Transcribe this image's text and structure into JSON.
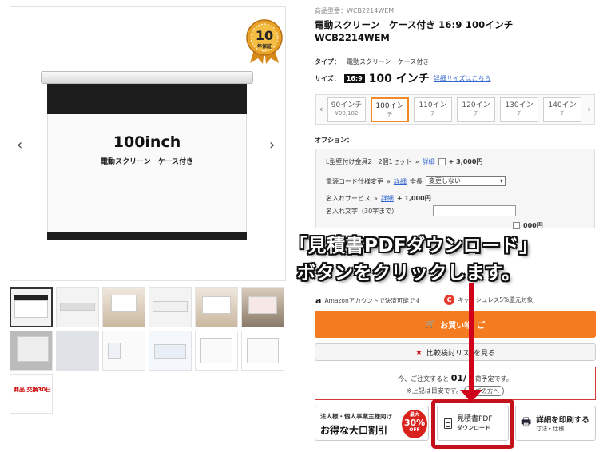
{
  "gallery": {
    "screen_text": "100inch",
    "screen_sub": "電動スクリーン　ケース付き",
    "badge_number": "10",
    "badge_text": "年保証",
    "prev_icon": "chevron-left",
    "next_icon": "chevron-right",
    "thumbs": [
      {
        "kind": "screen",
        "active": true
      },
      {
        "kind": "case"
      },
      {
        "kind": "room"
      },
      {
        "kind": "remote"
      },
      {
        "kind": "room"
      },
      {
        "kind": "room"
      },
      {
        "kind": "fabric"
      },
      {
        "kind": "fabric"
      },
      {
        "kind": "hand"
      },
      {
        "kind": "doc"
      },
      {
        "kind": "doc"
      },
      {
        "kind": "red",
        "text": "商品 交換30日"
      }
    ]
  },
  "product": {
    "code_label": "商品型番：",
    "code": "WCB2214WEM",
    "title_line1": "電動スクリーン　ケース付き 16:9 100インチ",
    "title_line2": "WCB2214WEM",
    "type_label": "タイプ：",
    "type_value": "電動スクリーン　ケース付き",
    "size_label": "サイズ：",
    "ratio": "16:9",
    "size_value": "100 インチ",
    "size_detail_link": "詳細サイズはこちら"
  },
  "sizes": [
    {
      "label": "90インチ",
      "price": "¥90,182"
    },
    {
      "label": "100イン",
      "price": "チ",
      "selected": true
    },
    {
      "label": "110イン",
      "price": "チ"
    },
    {
      "label": "120イン",
      "price": "チ"
    },
    {
      "label": "130イン",
      "price": "チ"
    },
    {
      "label": "140イン",
      "price": "チ"
    }
  ],
  "options": {
    "label": "オプション：",
    "rows": [
      {
        "text": "L型壁付け金具2　2個1セット",
        "link": "詳細",
        "price": "+ 3,000円"
      },
      {
        "text": "電源コード仕様変更",
        "link": "詳細",
        "extra": "全長",
        "select": "変更しない"
      },
      {
        "text": "名入れサービス",
        "link": "詳細",
        "price": "+ 1,000円"
      },
      {
        "text": "名入れ文字（30字まで）"
      },
      {
        "text": "＋",
        "price": "000円"
      }
    ]
  },
  "overlay": {
    "line1": "「見積書PDFダウンロード」",
    "line2": "ボタンをクリックします。"
  },
  "payment": {
    "amazon_mark": "a",
    "amazon_text": "Amazonアカウントで決済可能です",
    "cashless_mark": "C",
    "cashless_text": "キャッシュレス5%還元対象"
  },
  "buttons": {
    "buy": "お買い物",
    "buy_suffix": "ご",
    "compare": "比較検討リス",
    "compare_suffix": "を見る"
  },
  "shipping": {
    "line1": "今、ご注文すると",
    "date": "01/",
    "line1_suffix": "出荷予定です。",
    "line2": "※上記は目安です。",
    "pill": "急ぎの方へ"
  },
  "corp": {
    "line1": "法人様・個人事業主様向け",
    "line2": "お得な大口割引",
    "badge_top": "最大",
    "badge_num": "30%",
    "badge_bottom": "OFF"
  },
  "pdf_button": {
    "line1": "見積書PDF",
    "line2": "ダウンロード"
  },
  "print_button": {
    "line1": "詳細を印刷する",
    "line2": "寸法・仕様"
  },
  "colors": {
    "accent": "#f47b20",
    "annotation": "#c4121c",
    "link": "#3366cc"
  }
}
